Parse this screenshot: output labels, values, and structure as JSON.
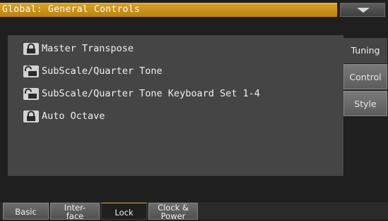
{
  "title": "Global: General Controls",
  "locks": [
    {
      "label": "Master Transpose",
      "state": "locked"
    },
    {
      "label": "SubScale/Quarter Tone",
      "state": "unlocked"
    },
    {
      "label": "SubScale/Quarter Tone Keyboard Set 1-4",
      "state": "unlocked"
    },
    {
      "label": "Auto Octave",
      "state": "locked"
    }
  ],
  "side_tabs": [
    {
      "label": "Tuning",
      "active": true
    },
    {
      "label": "Control",
      "active": false
    },
    {
      "label": "Style",
      "active": false
    }
  ],
  "bottom_tabs": [
    {
      "line1": "Basic",
      "line2": "",
      "active": false
    },
    {
      "line1": "Inter-",
      "line2": "face",
      "active": false
    },
    {
      "line1": "Lock",
      "line2": "",
      "active": true
    },
    {
      "line1": "Clock &",
      "line2": "Power",
      "active": false
    }
  ],
  "icons": {
    "menu": "triangle-down-icon",
    "locked": "padlock-closed-icon",
    "unlocked": "padlock-open-icon"
  },
  "colors": {
    "title_bar": "#c8931c",
    "panel": "#454545",
    "background": "#1f1f1f"
  }
}
